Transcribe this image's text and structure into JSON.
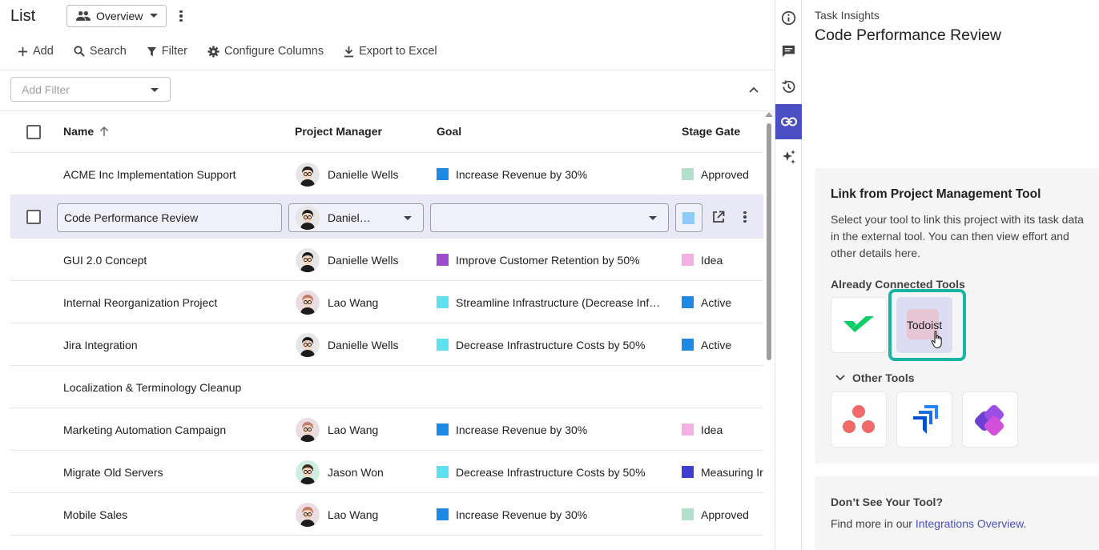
{
  "list": {
    "title": "List",
    "view_label": "Overview",
    "toolbar": {
      "add": "Add",
      "search": "Search",
      "filter": "Filter",
      "configure_columns": "Configure Columns",
      "export": "Export to Excel"
    },
    "filter_placeholder": "Add Filter",
    "columns": {
      "name": "Name",
      "manager": "Project Manager",
      "goal": "Goal",
      "stage": "Stage Gate"
    },
    "rows": [
      {
        "name": "ACME Inc Implementation Support",
        "manager": "Danielle Wells",
        "avatar": "dark",
        "goal": "Increase Revenue by 30%",
        "goal_color": "#1e88e5",
        "stage": "Approved",
        "stage_color": "#b2dfcb"
      },
      {
        "name": "Code Performance Review",
        "manager": "Daniel…",
        "avatar": "dark",
        "goal": "",
        "goal_color": "",
        "stage": "",
        "stage_color": "#90caf9",
        "selected": true
      },
      {
        "name": "GUI 2.0 Concept",
        "manager": "Danielle Wells",
        "avatar": "dark",
        "goal": "Improve Customer Retention by 50%",
        "goal_color": "#9c4dcc",
        "stage": "Idea",
        "stage_color": "#f3b0e3"
      },
      {
        "name": "Internal Reorganization Project",
        "manager": "Lao Wang",
        "avatar": "pink",
        "goal": "Streamline Infrastructure (Decrease Inf…",
        "goal_color": "#5ee0f0",
        "stage": "Active",
        "stage_color": "#1e88e5"
      },
      {
        "name": "Jira Integration",
        "manager": "Danielle Wells",
        "avatar": "dark",
        "goal": "Decrease Infrastructure Costs by 50%",
        "goal_color": "#5ee0f0",
        "stage": "Active",
        "stage_color": "#1e88e5"
      },
      {
        "name": "Localization & Terminology Cleanup",
        "manager": "",
        "avatar": "",
        "goal": "",
        "goal_color": "",
        "stage": "",
        "stage_color": ""
      },
      {
        "name": "Marketing Automation Campaign",
        "manager": "Lao Wang",
        "avatar": "pink",
        "goal": "Increase Revenue by 30%",
        "goal_color": "#1e88e5",
        "stage": "Idea",
        "stage_color": "#f3b0e3"
      },
      {
        "name": "Migrate Old Servers",
        "manager": "Jason Won",
        "avatar": "mint",
        "goal": "Decrease Infrastructure Costs by 50%",
        "goal_color": "#5ee0f0",
        "stage": "Measuring Ir",
        "stage_color": "#3f3fd0"
      },
      {
        "name": "Mobile Sales",
        "manager": "Lao Wang",
        "avatar": "pink",
        "goal": "Increase Revenue by 30%",
        "goal_color": "#1e88e5",
        "stage": "Approved",
        "stage_color": "#b2dfcb"
      }
    ]
  },
  "side": {
    "subtitle": "Task Insights",
    "title": "Code Performance Review",
    "card_heading": "Link from Project Management Tool",
    "card_desc": "Select your tool to link this project with its task data in the external tool. You can then view effort and other details here.",
    "connected_heading": "Already Connected Tools",
    "todoist_label": "Todoist",
    "other_heading": "Other Tools",
    "dont_see": "Don’t See Your Tool?",
    "find_more_prefix": "Find more in our ",
    "find_more_link": "Integrations Overview",
    "find_more_suffix": "."
  },
  "colors": {
    "accent": "#4a4fc4",
    "highlight_ring": "#19b5a4",
    "selected_row": "#e8e8f7"
  }
}
